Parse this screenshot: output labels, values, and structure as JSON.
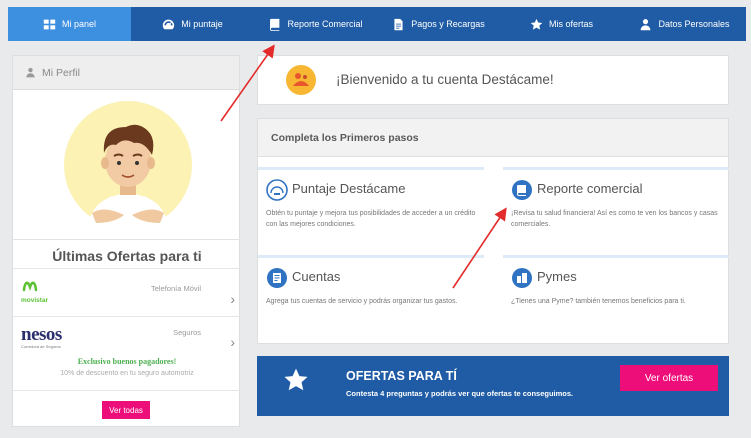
{
  "nav": {
    "items": [
      {
        "label": "Mi panel",
        "icon": "dashboard-icon"
      },
      {
        "label": "Mi puntaje",
        "icon": "speedometer-icon"
      },
      {
        "label": "Reporte Comercial",
        "icon": "book-icon"
      },
      {
        "label": "Pagos y Recargas",
        "icon": "document-icon"
      },
      {
        "label": "Mis ofertas",
        "icon": "star-icon"
      },
      {
        "label": "Datos Personales",
        "icon": "user-icon"
      }
    ],
    "active": "Mi panel"
  },
  "sidebar": {
    "header": "Mi Perfil",
    "ofertas_title": "Últimas Ofertas para ti",
    "offers": [
      {
        "brand": "movistar",
        "type": "Telefonía Móvil"
      },
      {
        "brand": "nesos",
        "brand_tagline": "Corredora de Seguros",
        "type": "Seguros",
        "promo_title": "Exclusivo buenos pagadores!",
        "promo_text": "10% de descuento en tu seguro automotriz"
      }
    ],
    "ver_todas": "Ver todas"
  },
  "welcome": {
    "text": "¡Bienvenido a tu cuenta Destácame!"
  },
  "steps": {
    "title": "Completa los Primeros pasos",
    "items": [
      {
        "title": "Puntaje Destácame",
        "desc": "Obtén tu puntaje y mejora tus posibilidades de acceder a un crédito con las mejores condiciones.",
        "icon": "score-icon"
      },
      {
        "title": "Reporte comercial",
        "desc": "¡Revisa tu salud financiera! Así es como te ven los bancos y casas comerciales.",
        "icon": "book-icon"
      },
      {
        "title": "Cuentas",
        "desc": "Agrega tus cuentas de servicio y podrás organizar tus gastos.",
        "icon": "bills-icon"
      },
      {
        "title": "Pymes",
        "desc": "¿Tienes una Pyme? también tenemos beneficios para ti.",
        "icon": "business-icon"
      }
    ]
  },
  "banner": {
    "title": "OFERTAS PARA TÍ",
    "subtitle": "Contesta 4 preguntas y podrás ver que ofertas te conseguimos.",
    "button": "Ver ofertas"
  },
  "colors": {
    "nav_bg": "#1f5ca5",
    "nav_active": "#3d8fe0",
    "accent_pink": "#ee0e7a",
    "promo_green": "#4caf50",
    "annotation_red": "#e32b2b"
  }
}
